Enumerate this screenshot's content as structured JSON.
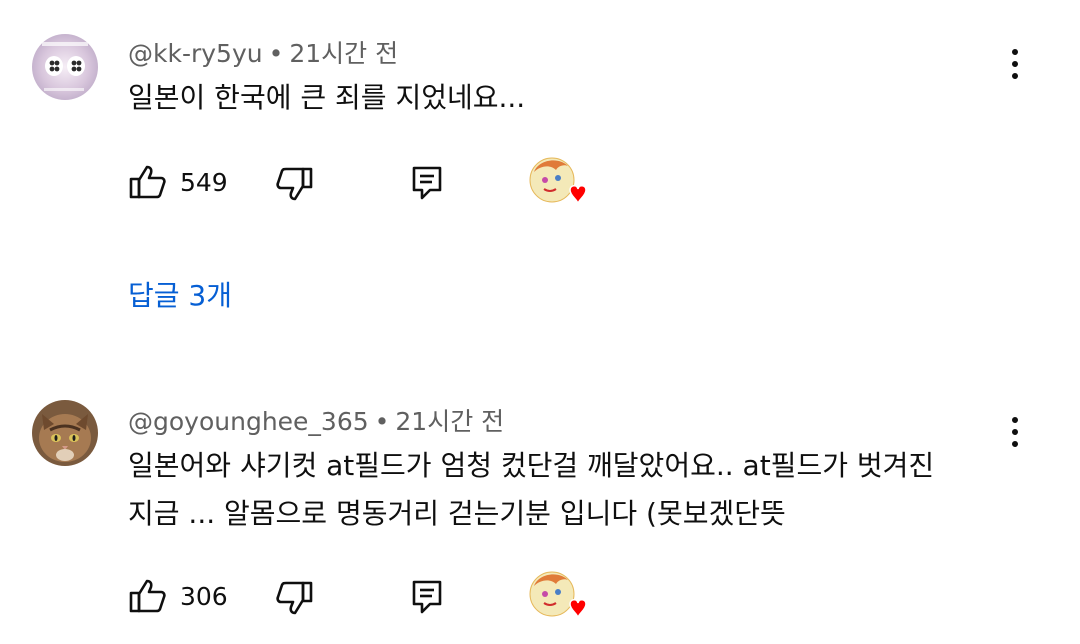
{
  "comments": [
    {
      "author": "@kk-ry5yu",
      "time": "21시간 전",
      "text_lines": [
        "일본이 한국에 큰 죄를 지었네요..."
      ],
      "likes": "549",
      "replies_label": "답글 3개"
    },
    {
      "author": "@goyounghee_365",
      "time": "21시간 전",
      "text_lines": [
        "일본어와 샤기컷 at필드가 엄청 컸단걸 깨달았어요.. at필드가 벗겨진",
        "지금 ... 알몸으로 명동거리 걷는기분 입니다 (못보겠단뜻"
      ],
      "likes": "306"
    }
  ],
  "separator": "•",
  "icons": {
    "like": "thumbs-up-icon",
    "dislike": "thumbs-down-icon",
    "reply": "comment-icon",
    "more": "more-vert-icon",
    "creator_heart": "creator-heart-icon"
  },
  "colors": {
    "link": "#065fd4",
    "meta": "#606060",
    "heart": "#ff0000"
  }
}
